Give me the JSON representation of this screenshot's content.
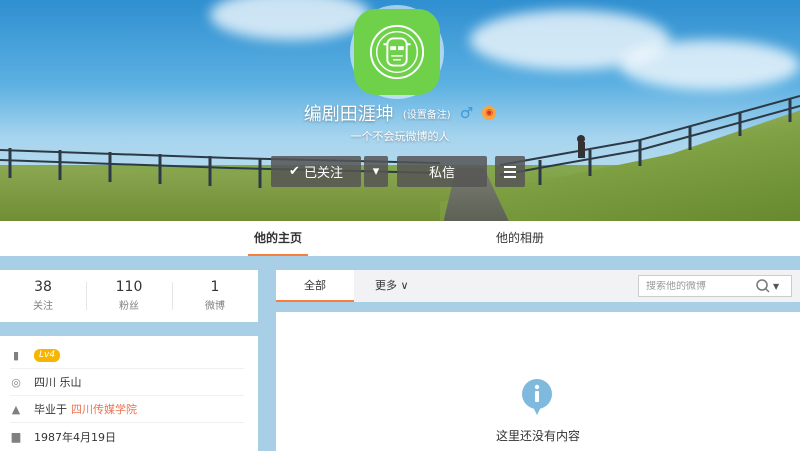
{
  "profile": {
    "nickname": "编剧田涯坤",
    "remark": "(设置备注)",
    "gender_symbol": "♂",
    "intro": "一个不会玩微博的人",
    "avatar_icon": "robot-face-icon",
    "avatar_color": "#6fd14a"
  },
  "actions": {
    "follow_label": "已关注",
    "follow_check": "✔",
    "dropdown_symbol": "▾",
    "message_label": "私信"
  },
  "tabs": {
    "home": "他的主页",
    "album": "他的相册"
  },
  "stats": [
    {
      "value": "38",
      "label": "关注"
    },
    {
      "value": "110",
      "label": "粉丝"
    },
    {
      "value": "1",
      "label": "微博"
    }
  ],
  "info": {
    "level": "Lv4",
    "location": "四川 乐山",
    "school_prefix": "毕业于",
    "school_name": "四川传媒学院",
    "birthday": "1987年4月19日"
  },
  "feed": {
    "tab_all": "全部",
    "tab_more": "更多 ∨",
    "search_placeholder": "搜索他的微博",
    "empty_text": "这里还没有内容"
  },
  "colors": {
    "accent": "#fa7d3c",
    "link": "#eb7350",
    "level_badge": "#f7b500"
  }
}
